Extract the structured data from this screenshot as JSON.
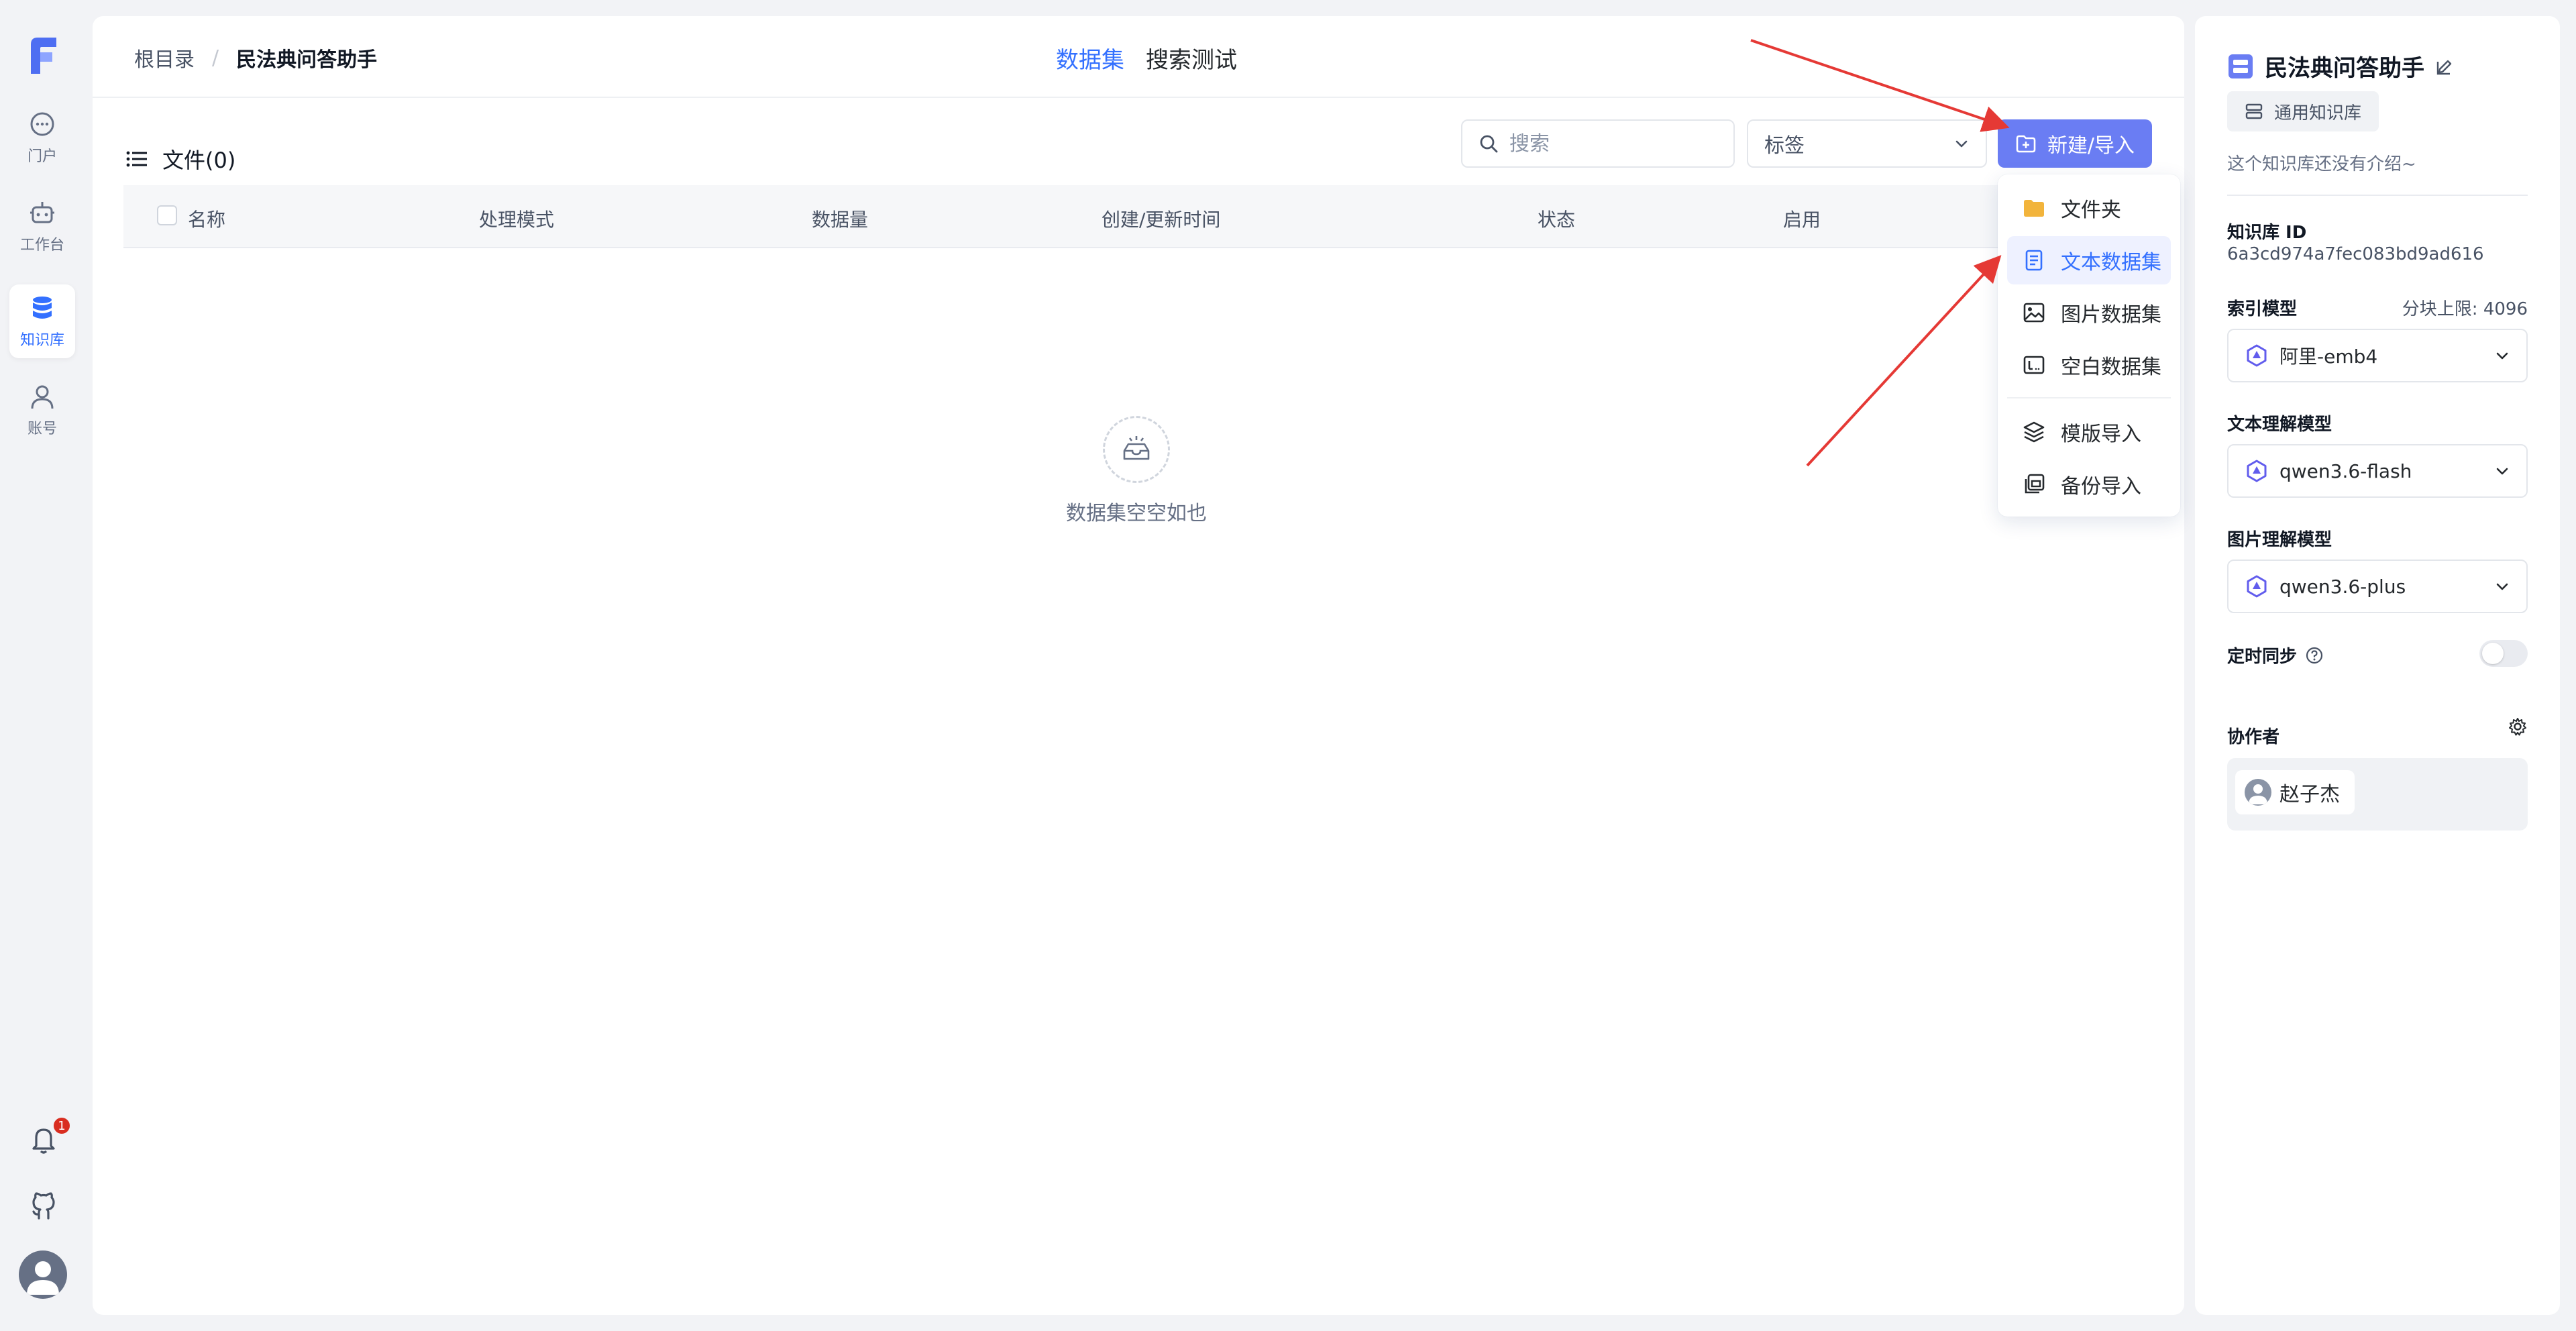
{
  "nav": {
    "items": [
      {
        "label": "门户",
        "icon": "chat-icon"
      },
      {
        "label": "工作台",
        "icon": "robot-icon"
      },
      {
        "label": "知识库",
        "icon": "database-icon"
      },
      {
        "label": "账号",
        "icon": "user-icon"
      }
    ],
    "notification_count": "1"
  },
  "breadcrumb": {
    "root": "根目录",
    "separator": "/",
    "current": "民法典问答助手"
  },
  "tabs": [
    "数据集",
    "搜索测试"
  ],
  "files": {
    "title": "文件(0)"
  },
  "search": {
    "placeholder": "搜索"
  },
  "tag_filter": {
    "value": "标签"
  },
  "new_button": {
    "label": "新建/导入"
  },
  "table": {
    "columns": [
      "名称",
      "处理模式",
      "数据量",
      "创建/更新时间",
      "状态",
      "启用"
    ],
    "empty_text": "数据集空空如也"
  },
  "menu": {
    "items": [
      {
        "label": "文件夹",
        "icon": "folder-icon"
      },
      {
        "label": "文本数据集",
        "icon": "text-doc-icon"
      },
      {
        "label": "图片数据集",
        "icon": "image-icon"
      },
      {
        "label": "空白数据集",
        "icon": "blank-dataset-icon"
      },
      {
        "label": "模版导入",
        "icon": "layers-icon"
      },
      {
        "label": "备份导入",
        "icon": "backup-icon"
      }
    ]
  },
  "info": {
    "title": "民法典问答助手",
    "type_badge": "通用知识库",
    "intro": "这个知识库还没有介绍~",
    "id_label": "知识库 ID",
    "id_value": "6a3cd974a7fec083bd9ad616",
    "index_model_label": "索引模型",
    "chunk_limit": "分块上限: 4096",
    "index_model": "阿里-emb4",
    "text_model_label": "文本理解模型",
    "text_model": "qwen3.6-flash",
    "image_model_label": "图片理解模型",
    "image_model": "qwen3.6-plus",
    "sync_label": "定时同步",
    "collaborators_label": "协作者",
    "collaborator": "赵子杰"
  },
  "colors": {
    "accent": "#3370ff",
    "button": "#6a7df3",
    "arrow": "#e53935"
  }
}
